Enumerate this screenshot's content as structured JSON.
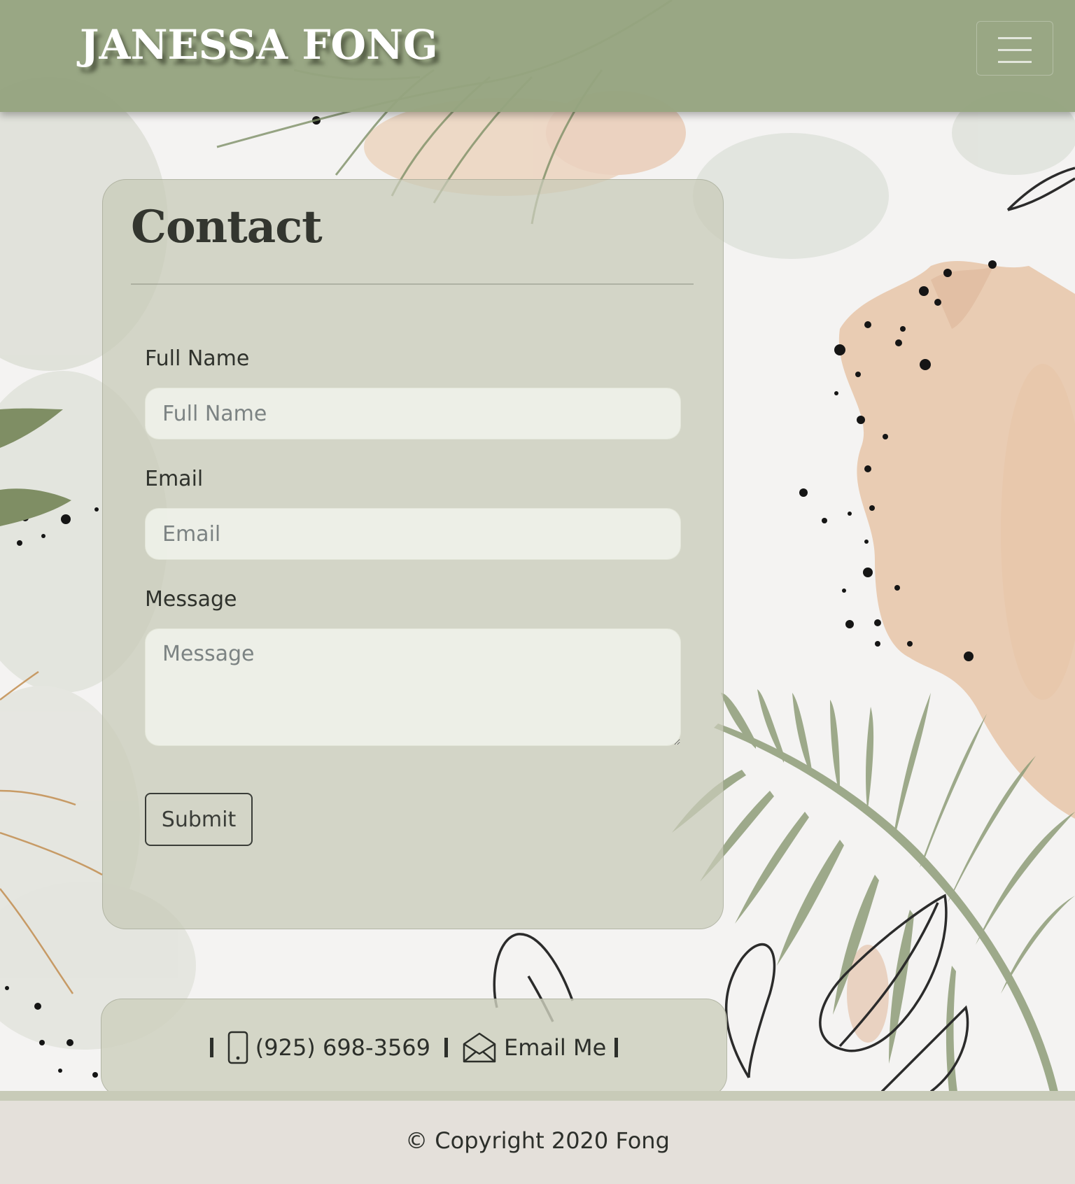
{
  "navbar": {
    "brand": "JANESSA FONG",
    "menu_icon": "hamburger-menu-icon"
  },
  "contact_form": {
    "title": "Contact",
    "fields": {
      "full_name": {
        "label": "Full Name",
        "placeholder": "Full Name",
        "value": ""
      },
      "email": {
        "label": "Email",
        "placeholder": "Email",
        "value": ""
      },
      "message": {
        "label": "Message",
        "placeholder": "Message",
        "value": ""
      }
    },
    "submit_label": "Submit"
  },
  "contact_bar": {
    "phone_icon": "mobile-phone-icon",
    "phone": "(925) 698-3569",
    "email_icon": "open-envelope-icon",
    "email_label": "Email Me"
  },
  "footer": {
    "copyright": "© Copyright 2020 Fong"
  },
  "colors": {
    "navbar_green": "#96a480",
    "card_sage": "#c8cbb7",
    "footer_beige": "#e4e0da",
    "text_dark": "#33362f",
    "watercolor_peach": "#e8c3a4",
    "fern_green": "#8d9c78"
  }
}
